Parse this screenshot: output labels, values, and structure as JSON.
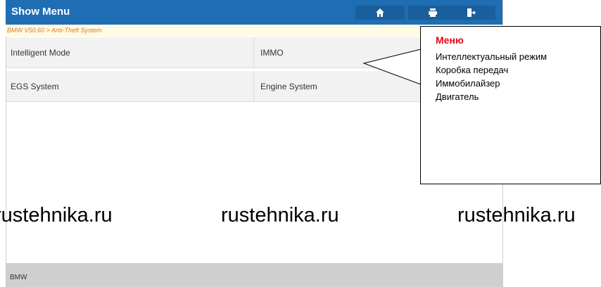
{
  "header": {
    "title": "Show Menu",
    "buttons": [
      {
        "icon": "home-icon"
      },
      {
        "icon": "print-icon"
      },
      {
        "icon": "exit-icon"
      }
    ]
  },
  "breadcrumb": "BMW V50.60 > Anti-Theft System",
  "menu": {
    "items": [
      "Intelligent Mode",
      "IMMO",
      "EGS System",
      "Engine System"
    ]
  },
  "footer": {
    "label": "BMW"
  },
  "callout": {
    "title": "Меню",
    "items": [
      "Интеллектуальный режим",
      "Коробка передач",
      "Иммобилайзер",
      "Двигатель"
    ]
  },
  "watermarks": [
    "rustehnika.ru",
    "rustehnika.ru",
    "rustehnika.ru"
  ],
  "colors": {
    "header": "#1f6eb4",
    "callout_title": "#e30613",
    "breadcrumb_text": "#e07a2a"
  }
}
